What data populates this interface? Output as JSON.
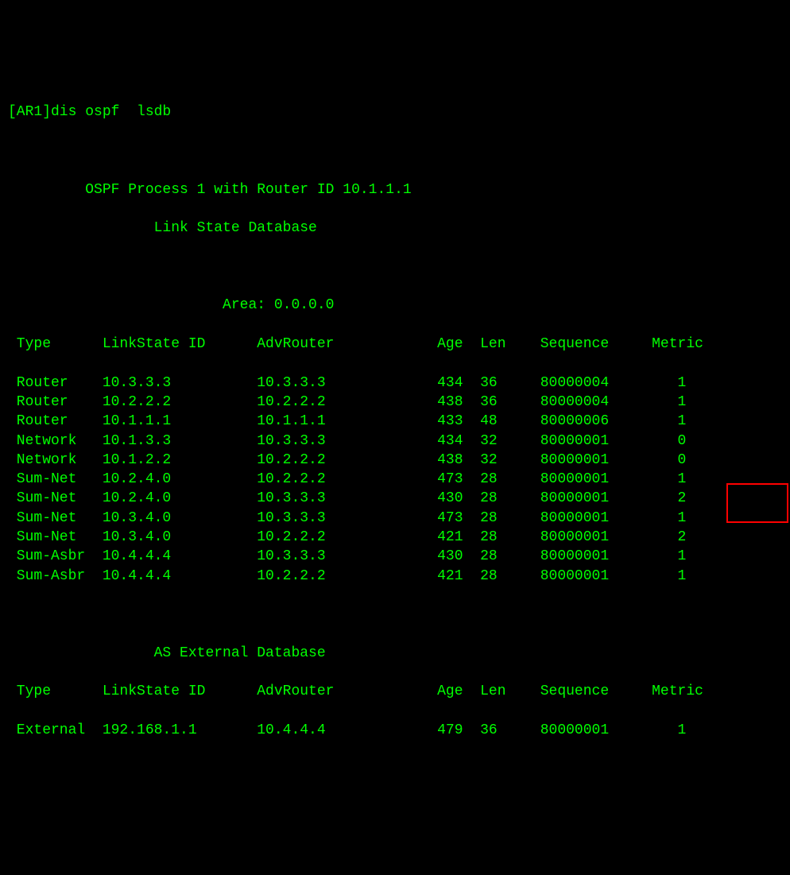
{
  "prompt": "[AR1]dis ospf  lsdb",
  "header": {
    "process_line": "         OSPF Process 1 with Router ID 10.1.1.1",
    "subtitle": "                 Link State Database"
  },
  "area_section": {
    "area_label": "                         Area: 0.0.0.0",
    "columns": {
      "type": "Type",
      "linkstate_id": "LinkState ID",
      "adv_router": "AdvRouter",
      "age": "Age",
      "len": "Len",
      "sequence": "Sequence",
      "metric": "Metric"
    },
    "rows": [
      {
        "type": "Router",
        "ls_id": "10.3.3.3",
        "adv": "10.3.3.3",
        "age": "434",
        "len": "36",
        "seq": "80000004",
        "metric": "1"
      },
      {
        "type": "Router",
        "ls_id": "10.2.2.2",
        "adv": "10.2.2.2",
        "age": "438",
        "len": "36",
        "seq": "80000004",
        "metric": "1"
      },
      {
        "type": "Router",
        "ls_id": "10.1.1.1",
        "adv": "10.1.1.1",
        "age": "433",
        "len": "48",
        "seq": "80000006",
        "metric": "1"
      },
      {
        "type": "Network",
        "ls_id": "10.1.3.3",
        "adv": "10.3.3.3",
        "age": "434",
        "len": "32",
        "seq": "80000001",
        "metric": "0"
      },
      {
        "type": "Network",
        "ls_id": "10.1.2.2",
        "adv": "10.2.2.2",
        "age": "438",
        "len": "32",
        "seq": "80000001",
        "metric": "0"
      },
      {
        "type": "Sum-Net",
        "ls_id": "10.2.4.0",
        "adv": "10.2.2.2",
        "age": "473",
        "len": "28",
        "seq": "80000001",
        "metric": "1"
      },
      {
        "type": "Sum-Net",
        "ls_id": "10.2.4.0",
        "adv": "10.3.3.3",
        "age": "430",
        "len": "28",
        "seq": "80000001",
        "metric": "2"
      },
      {
        "type": "Sum-Net",
        "ls_id": "10.3.4.0",
        "adv": "10.3.3.3",
        "age": "473",
        "len": "28",
        "seq": "80000001",
        "metric": "1"
      },
      {
        "type": "Sum-Net",
        "ls_id": "10.3.4.0",
        "adv": "10.2.2.2",
        "age": "421",
        "len": "28",
        "seq": "80000001",
        "metric": "2"
      },
      {
        "type": "Sum-Asbr",
        "ls_id": "10.4.4.4",
        "adv": "10.3.3.3",
        "age": "430",
        "len": "28",
        "seq": "80000001",
        "metric": "1"
      },
      {
        "type": "Sum-Asbr",
        "ls_id": "10.4.4.4",
        "adv": "10.2.2.2",
        "age": "421",
        "len": "28",
        "seq": "80000001",
        "metric": "1"
      }
    ]
  },
  "external_section": {
    "title": "                 AS External Database",
    "columns": {
      "type": "Type",
      "linkstate_id": "LinkState ID",
      "adv_router": "AdvRouter",
      "age": "Age",
      "len": "Len",
      "sequence": "Sequence",
      "metric": "Metric"
    },
    "rows": [
      {
        "type": "External",
        "ls_id": "192.168.1.1",
        "adv": "10.4.4.4",
        "age": "479",
        "len": "36",
        "seq": "80000001",
        "metric": "1"
      }
    ]
  }
}
